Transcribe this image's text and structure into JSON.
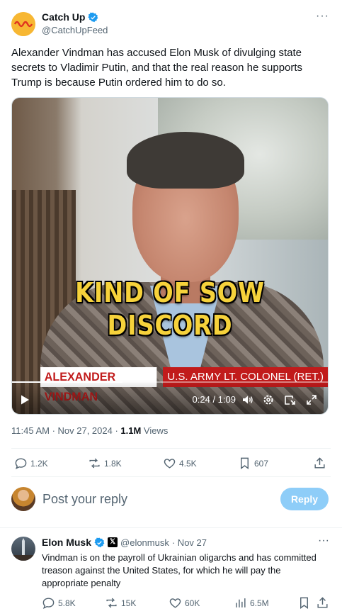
{
  "post": {
    "display_name": "Catch Up",
    "handle": "@CatchUpFeed",
    "more": "···",
    "text": "Alexander Vindman has accused Elon Musk of divulging state secrets to Vladimir Putin, and that the real reason he supports Trump is because Putin ordered him to do so.",
    "avatar_color": "#f7b733",
    "verified_color": "#1d9bf0"
  },
  "video": {
    "caption_line1": "KIND OF SOW",
    "caption_line2": "DISCORD",
    "lower_third_name": "ALEXANDER VINDMAN",
    "lower_third_title": "U.S. ARMY LT. COLONEL (RET.)",
    "time": "0:24 / 1:09",
    "progress": 0.35,
    "caption_color": "#f6d23b",
    "lower_third_color": "#c11b1b"
  },
  "meta": {
    "timestamp": "11:45 AM · Nov 27, 2024 · ",
    "views_count": "1.1M",
    "views_label": " Views"
  },
  "actions": {
    "replies": "1.2K",
    "reposts": "1.8K",
    "likes": "4.5K",
    "bookmarks": "607"
  },
  "compose": {
    "placeholder": "Post your reply",
    "button": "Reply",
    "button_color": "#8ecdf8"
  },
  "reply": {
    "display_name": "Elon Musk",
    "handle": "@elonmusk",
    "date": "· Nov 27",
    "more": "···",
    "text": "Vindman is on the payroll of Ukrainian oligarchs and has committed treason against the United States, for which he will pay the appropriate penalty",
    "actions": {
      "replies": "5.8K",
      "reposts": "15K",
      "likes": "60K",
      "views": "6.5M"
    }
  }
}
